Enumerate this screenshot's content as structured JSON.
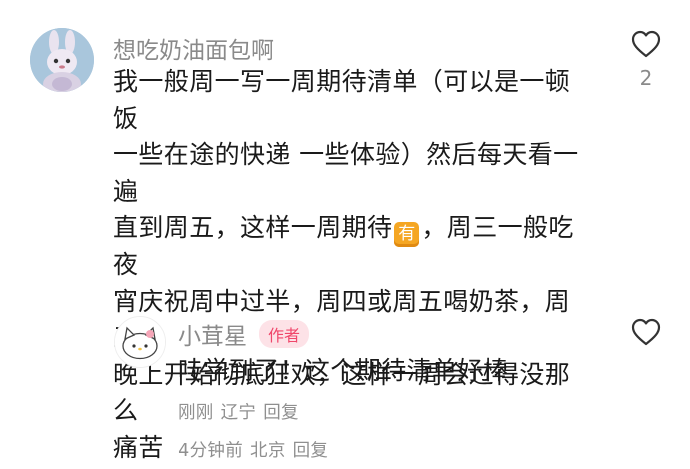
{
  "comments": [
    {
      "username": "想吃奶油面包啊",
      "avatar_icon": "bunny-plush-avatar",
      "text_lines": [
        "我一般周一写一周期待清单（可以是一顿饭",
        "一些在途的快递 一些体验）然后每天看一遍",
        "直到周五，这样一周期待",
        "宵庆祝周中过半，周四或周五喝奶茶，周五",
        "晚上开始彻底狂欢，这样一周会过得没那么",
        "痛苦"
      ],
      "emoji_label": "有",
      "line3_tail": "，周三一般吃夜",
      "time": "4分钟前",
      "location": "北京",
      "reply_label": "回复",
      "likes": "2"
    },
    {
      "username": "小茸星",
      "avatar_icon": "hello-kitty-avatar",
      "badge": "作者",
      "text": "哇学到了！这个期待清单好棒",
      "time": "刚刚",
      "location": "辽宁",
      "reply_label": "回复"
    }
  ],
  "colors": {
    "username": "#8a8a8a",
    "text": "#1a1a1a",
    "meta": "#8f8f8f",
    "author_badge_bg": "#fde2e7",
    "author_badge_text": "#f0476b",
    "emoji_bg": "#f5a623"
  }
}
